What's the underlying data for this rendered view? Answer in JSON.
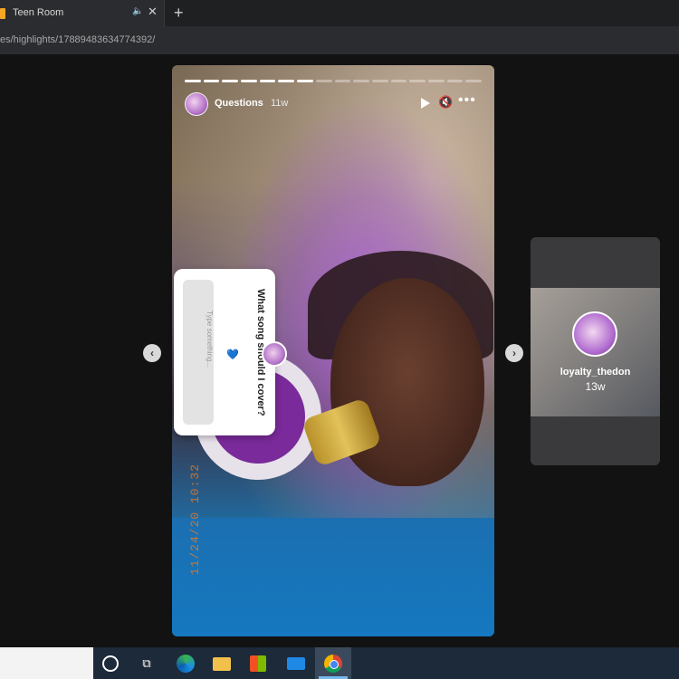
{
  "browser": {
    "tab": {
      "title": "Teen Room",
      "audio_icon": "🔈",
      "close_icon": "✕"
    },
    "new_tab_icon": "+",
    "address": "es/highlights/17889483634774392/"
  },
  "story": {
    "username": "Questions",
    "time_ago": "11w",
    "progress": {
      "total_segments": 16,
      "completed_segments": 7
    },
    "controls": {
      "play": "play-icon",
      "mute": "🔇",
      "more": "•••"
    },
    "question_sticker": {
      "question": "What song should I cover?",
      "placeholder": "Type something...",
      "heart": "💙"
    },
    "date_stamp": "11/24/20 10:32"
  },
  "navigation": {
    "prev": "‹",
    "next": "›"
  },
  "next_story_preview": {
    "username": "loyalty_thedon",
    "time_ago": "13w"
  },
  "taskbar": {
    "icons": [
      "cortana-icon",
      "task-view-icon",
      "edge-icon",
      "file-explorer-icon",
      "store-icon",
      "mail-icon",
      "chrome-icon"
    ],
    "task_view_glyph": "⧉"
  }
}
